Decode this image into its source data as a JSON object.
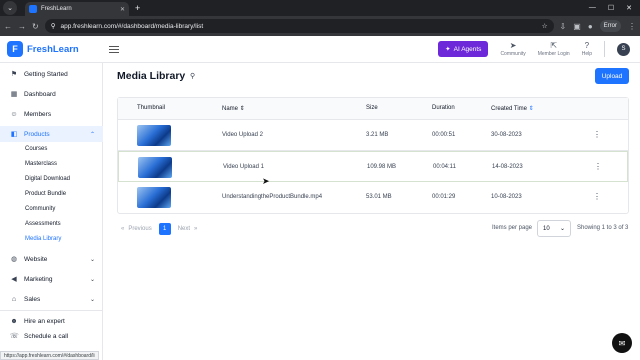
{
  "browser": {
    "tab_title": "FreshLearn",
    "new_tab": "+",
    "url": "app.freshlearn.com/#/dashboard/media-library/list",
    "profile": "Error",
    "status_url": "https://app.freshlearn.com/#/dashboard/li"
  },
  "header": {
    "brand": "FreshLearn",
    "ai_button": "AI Agents",
    "items": [
      {
        "icon": "community-icon",
        "label": "Community"
      },
      {
        "icon": "member-login-icon",
        "label": "Member Login"
      },
      {
        "icon": "help-icon",
        "label": "Help"
      }
    ],
    "avatar": "S"
  },
  "sidebar": {
    "items": [
      {
        "label": "Getting Started",
        "icon": "rocket-icon"
      },
      {
        "label": "Dashboard",
        "icon": "dashboard-icon"
      },
      {
        "label": "Members",
        "icon": "members-icon"
      },
      {
        "label": "Products",
        "icon": "products-icon"
      },
      {
        "label": "Website",
        "icon": "globe-icon"
      },
      {
        "label": "Marketing",
        "icon": "megaphone-icon"
      },
      {
        "label": "Sales",
        "icon": "bank-icon"
      },
      {
        "label": "Hire an expert",
        "icon": "expert-icon"
      },
      {
        "label": "Schedule a call",
        "icon": "phone-icon"
      }
    ],
    "products_sub": [
      "Courses",
      "Masterclass",
      "Digital Download",
      "Product Bundle",
      "Community",
      "Assessments",
      "Media Library"
    ]
  },
  "main": {
    "title": "Media Library",
    "upload": "Upload",
    "columns": [
      "Thumbnail",
      "Name",
      "Size",
      "Duration",
      "Created Time"
    ],
    "rows": [
      {
        "name": "Video Upload 2",
        "size": "3.21 MB",
        "duration": "00:00:51",
        "created": "30-08-2023"
      },
      {
        "name": "Video Upload 1",
        "size": "109.98 MB",
        "duration": "00:04:11",
        "created": "14-08-2023"
      },
      {
        "name": "UnderstandingtheProductBundle.mp4",
        "size": "53.01 MB",
        "duration": "00:01:29",
        "created": "10-08-2023"
      }
    ],
    "pagination": {
      "previous": "Previous",
      "page": "1",
      "next": "Next",
      "per_page_label": "Items per page",
      "per_page_value": "10",
      "showing": "Showing 1 to 3 of 3"
    }
  }
}
